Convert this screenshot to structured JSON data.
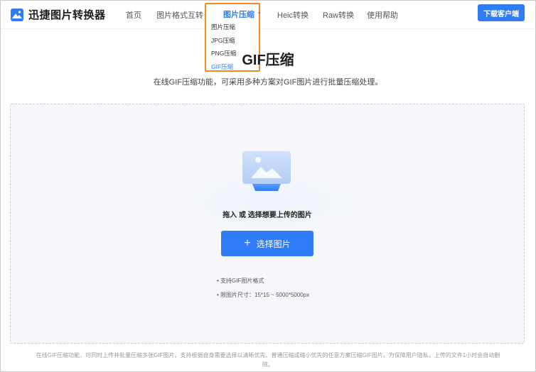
{
  "brand": {
    "name": "迅捷图片转换器",
    "logo_icon": "image-mountain-icon",
    "accent": "#2f7cf6"
  },
  "nav": {
    "items": [
      {
        "label": "首页"
      },
      {
        "label": "图片格式互转"
      },
      {
        "label": "图片压缩"
      },
      {
        "label": "Heic转换"
      },
      {
        "label": "Raw转换"
      },
      {
        "label": "使用帮助"
      }
    ],
    "download_label": "下载客户端"
  },
  "dropdown": {
    "title": "图片压缩",
    "items": [
      {
        "label": "图片压缩"
      },
      {
        "label": "JPG压缩"
      },
      {
        "label": "PNG压缩"
      },
      {
        "label": "GIF压缩"
      }
    ],
    "highlight_color": "#f08a24"
  },
  "main": {
    "title": "GIF压缩",
    "subtitle": "在线GIF压缩功能，可采用多种方案对GIF图片进行批量压缩处理。"
  },
  "upload": {
    "drop_text": "拖入 或 选择想要上传的图片",
    "button_label": "选择图片",
    "tips": [
      "• 支持GIF图片格式",
      "• 限图片尺寸：15*15 ~ 5000*5000px"
    ]
  },
  "footer_note": "在线GIF压缩功能，可同时上传并批量压缩多张GIF图片。支持根据自身需要选择以清晰优先、普通压缩或缩小优先的任意方案压缩GIF图片。为保障用户隐私，上传的文件1小时会自动删除。"
}
